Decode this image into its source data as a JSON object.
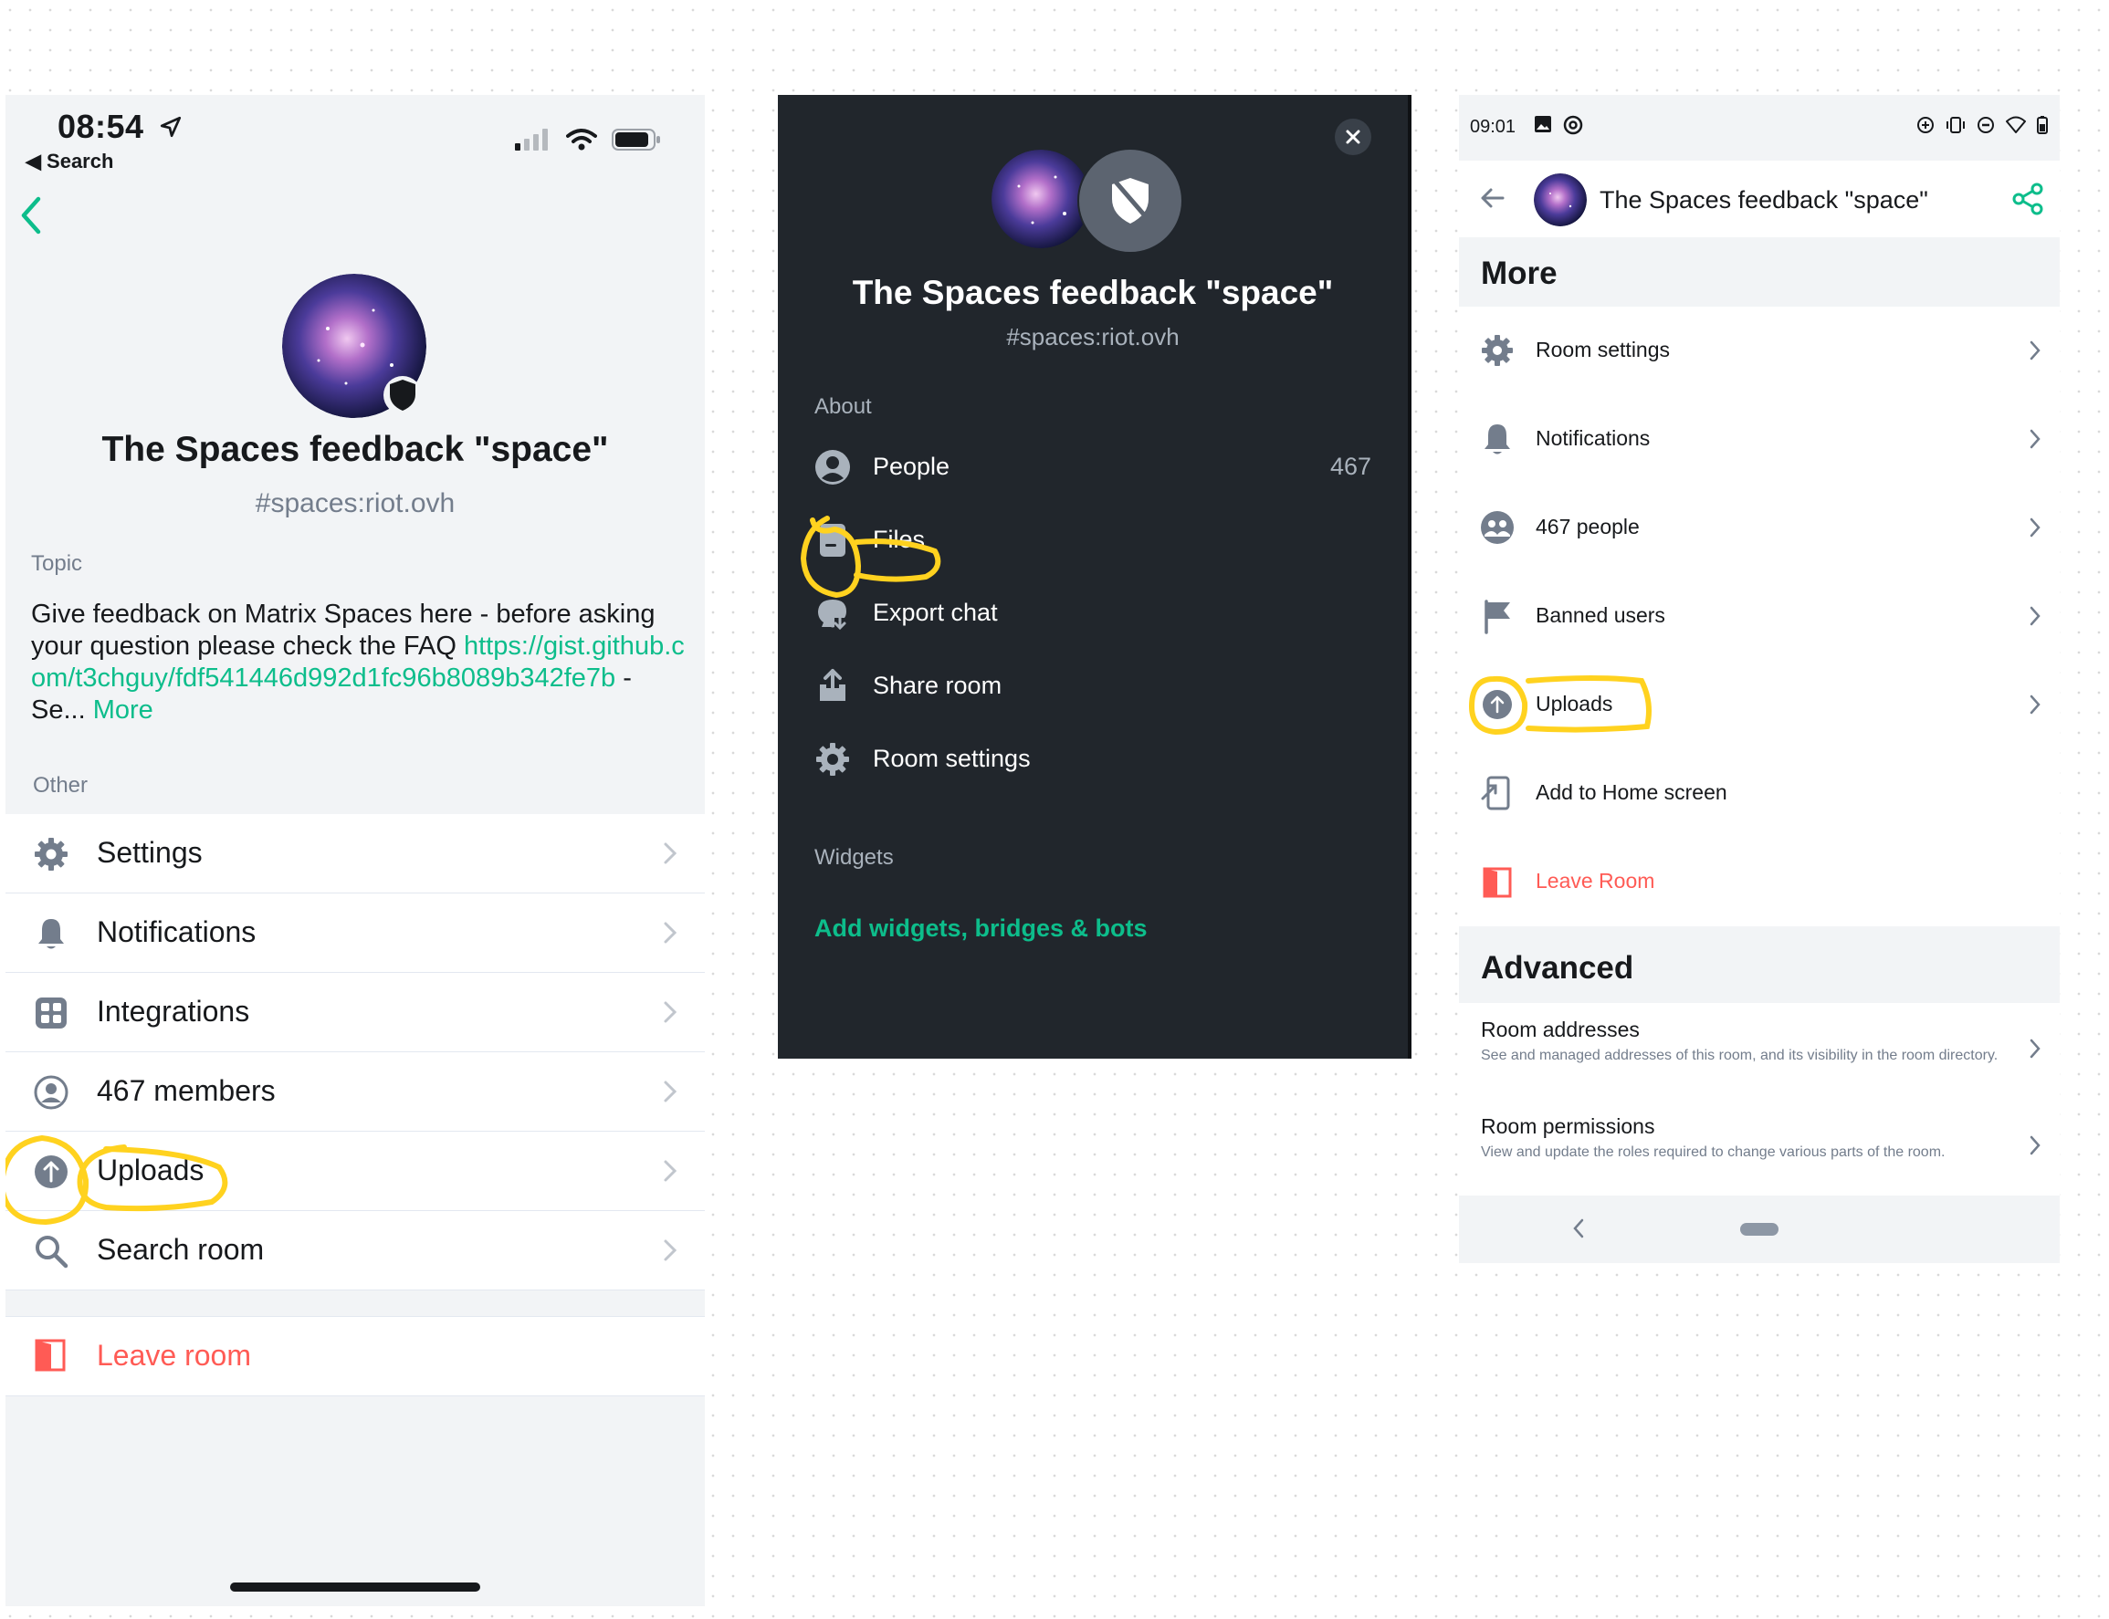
{
  "ios": {
    "time": "08:54",
    "back_label": "◀ Search",
    "room_name": "The Spaces feedback \"space\"",
    "room_alias": "#spaces:riot.ovh",
    "topic_label": "Topic",
    "topic_text": "Give feedback on Matrix Spaces here - before asking your question please check the FAQ ",
    "topic_link": "https://gist.github.com/t3chguy/fdf541446d992d1fc96b8089b342fe7b",
    "topic_suffix": " - Se... ",
    "topic_more": "More",
    "other_label": "Other",
    "items": [
      {
        "label": "Settings",
        "icon": "gear-icon"
      },
      {
        "label": "Notifications",
        "icon": "bell-icon"
      },
      {
        "label": "Integrations",
        "icon": "grid-icon"
      },
      {
        "label": "467 members",
        "icon": "user-circle-icon"
      },
      {
        "label": "Uploads",
        "icon": "upload-icon"
      },
      {
        "label": "Search room",
        "icon": "search-icon"
      }
    ],
    "leave_label": "Leave room"
  },
  "web": {
    "room_name": "The Spaces feedback \"space\"",
    "room_alias": "#spaces:riot.ovh",
    "about_label": "About",
    "items": [
      {
        "label": "People",
        "count": "467",
        "icon": "person-icon"
      },
      {
        "label": "Files",
        "icon": "file-icon"
      },
      {
        "label": "Export chat",
        "icon": "export-chat-icon"
      },
      {
        "label": "Share room",
        "icon": "share-icon"
      },
      {
        "label": "Room settings",
        "icon": "gear-icon"
      }
    ],
    "widgets_label": "Widgets",
    "add_widgets": "Add widgets, bridges & bots"
  },
  "android": {
    "time": "09:01",
    "title": "The Spaces feedback \"space\"",
    "more_header": "More",
    "items": [
      {
        "label": "Room settings",
        "icon": "gear-icon"
      },
      {
        "label": "Notifications",
        "icon": "bell-icon"
      },
      {
        "label": "467 people",
        "icon": "people-icon"
      },
      {
        "label": "Banned users",
        "icon": "flag-icon"
      },
      {
        "label": "Uploads",
        "icon": "upload-icon"
      },
      {
        "label": "Add to Home screen",
        "icon": "add-home-icon"
      },
      {
        "label": "Leave Room",
        "icon": "leave-icon"
      }
    ],
    "advanced_header": "Advanced",
    "advanced": [
      {
        "title": "Room addresses",
        "desc": "See and managed addresses of this room, and its visibility in the room directory."
      },
      {
        "title": "Room permissions",
        "desc": "View and update the roles required to change various parts of the room."
      }
    ]
  },
  "colors": {
    "accent": "#0dbd8b",
    "danger": "#ff5b55",
    "highlight": "#ffd21f",
    "dark_bg": "#21262c"
  }
}
